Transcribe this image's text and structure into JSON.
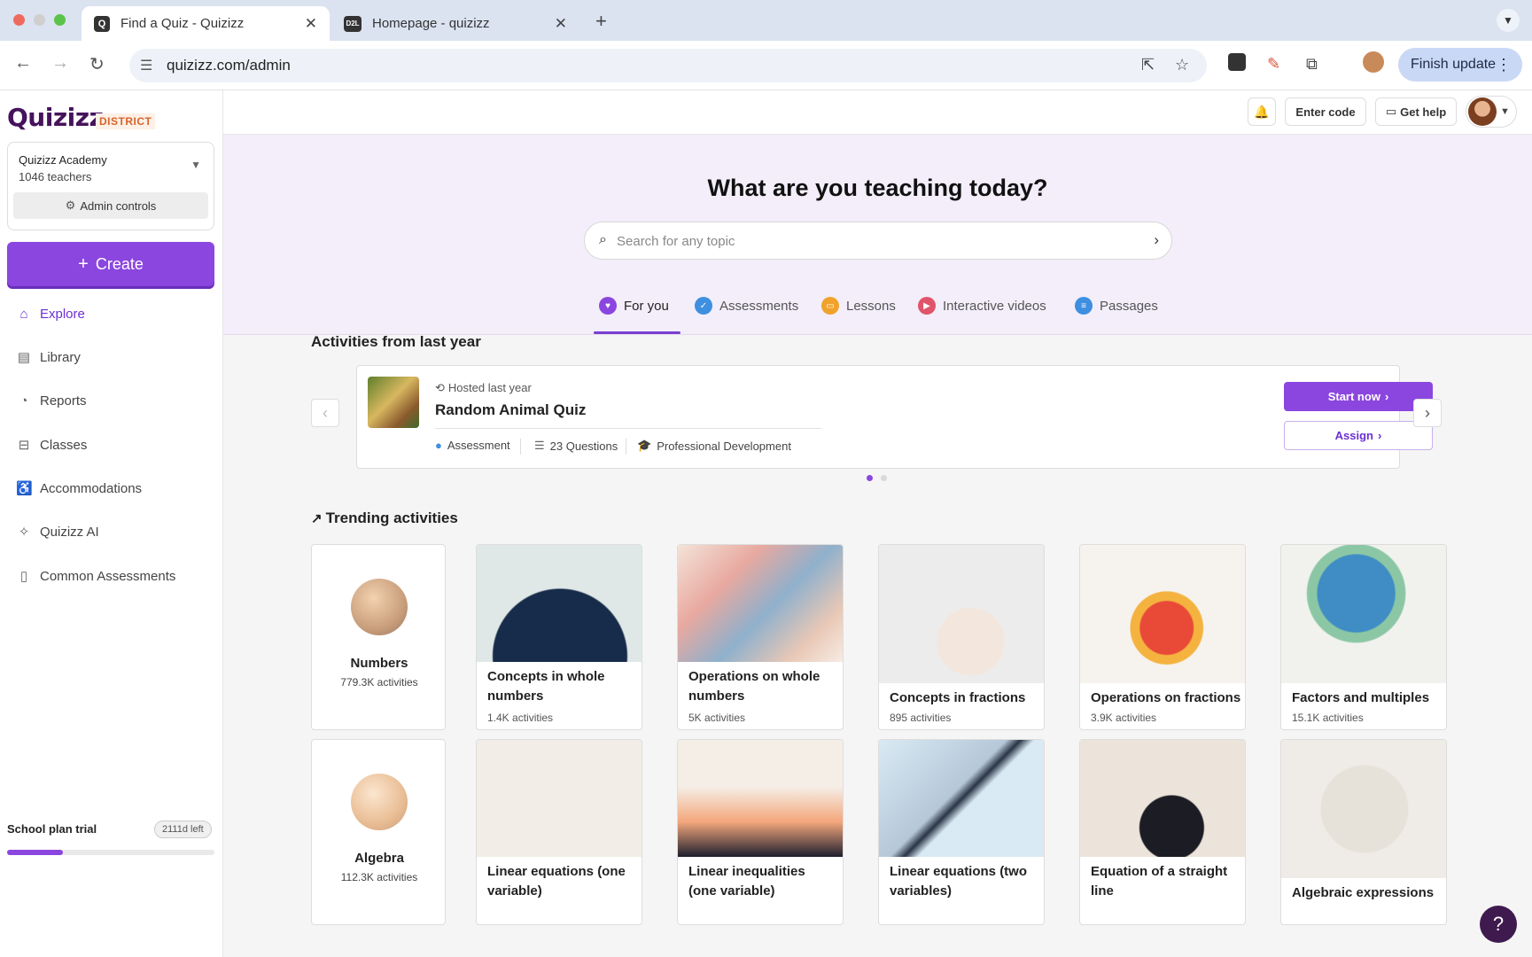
{
  "browser": {
    "tabs": [
      {
        "title": "Find a Quiz - Quizizz",
        "favicon": "Q"
      },
      {
        "title": "Homepage - quizizz",
        "favicon": "D2L"
      }
    ],
    "url": "quizizz.com/admin",
    "finish_update_label": "Finish update",
    "traffic_colors": [
      "#ee6a5f",
      "#cfcfcf",
      "#5bc349"
    ]
  },
  "sidebar": {
    "logo": "Quizizz",
    "logo_badge": "DISTRICT",
    "org_name": "Quizizz Academy",
    "org_teachers": "1046 teachers",
    "admin_controls": "Admin controls",
    "create_label": "Create",
    "nav": [
      {
        "label": "Explore",
        "icon": "home-icon"
      },
      {
        "label": "Library",
        "icon": "library-icon"
      },
      {
        "label": "Reports",
        "icon": "reports-icon"
      },
      {
        "label": "Classes",
        "icon": "classes-icon"
      },
      {
        "label": "Accommodations",
        "icon": "accommodations-icon"
      },
      {
        "label": "Quizizz AI",
        "icon": "sparkle-icon"
      },
      {
        "label": "Common Assessments",
        "icon": "clipboard-icon"
      }
    ],
    "plan_label": "School plan trial",
    "plan_days": "2111d left",
    "plan_progress": 0.27
  },
  "topbar": {
    "enter_code": "Enter code",
    "get_help": "Get help"
  },
  "hero": {
    "title": "What are you teaching today?",
    "search_placeholder": "Search for any topic",
    "tabs": [
      {
        "label": "For you",
        "color": "#8b46df"
      },
      {
        "label": "Assessments",
        "color": "#3f8fe0"
      },
      {
        "label": "Lessons",
        "color": "#f0a22a"
      },
      {
        "label": "Interactive videos",
        "color": "#e0546a"
      },
      {
        "label": "Passages",
        "color": "#3f8fe0"
      }
    ]
  },
  "activities": {
    "title": "Activities from last year",
    "card": {
      "hosted": "Hosted last year",
      "name": "Random Animal Quiz",
      "type": "Assessment",
      "questions": "23 Questions",
      "category": "Professional Development",
      "start_label": "Start now",
      "assign_label": "Assign"
    }
  },
  "trending": {
    "title": "Trending activities",
    "row1": [
      {
        "name": "Numbers",
        "count": "779.3K activities"
      },
      {
        "name": "Concepts in whole numbers",
        "count": "1.4K activities"
      },
      {
        "name": "Operations on whole numbers",
        "count": "5K activities"
      },
      {
        "name": "Concepts in fractions",
        "count": "895 activities"
      },
      {
        "name": "Operations on fractions",
        "count": "3.9K activities"
      },
      {
        "name": "Factors and multiples",
        "count": "15.1K activities"
      }
    ],
    "row2": [
      {
        "name": "Algebra",
        "count": "112.3K activities"
      },
      {
        "name": "Linear equations (one variable)"
      },
      {
        "name": "Linear inequalities (one variable)"
      },
      {
        "name": "Linear equations (two variables)"
      },
      {
        "name": "Equation of a straight line"
      },
      {
        "name": "Algebraic expressions"
      }
    ]
  },
  "help_label": "?"
}
